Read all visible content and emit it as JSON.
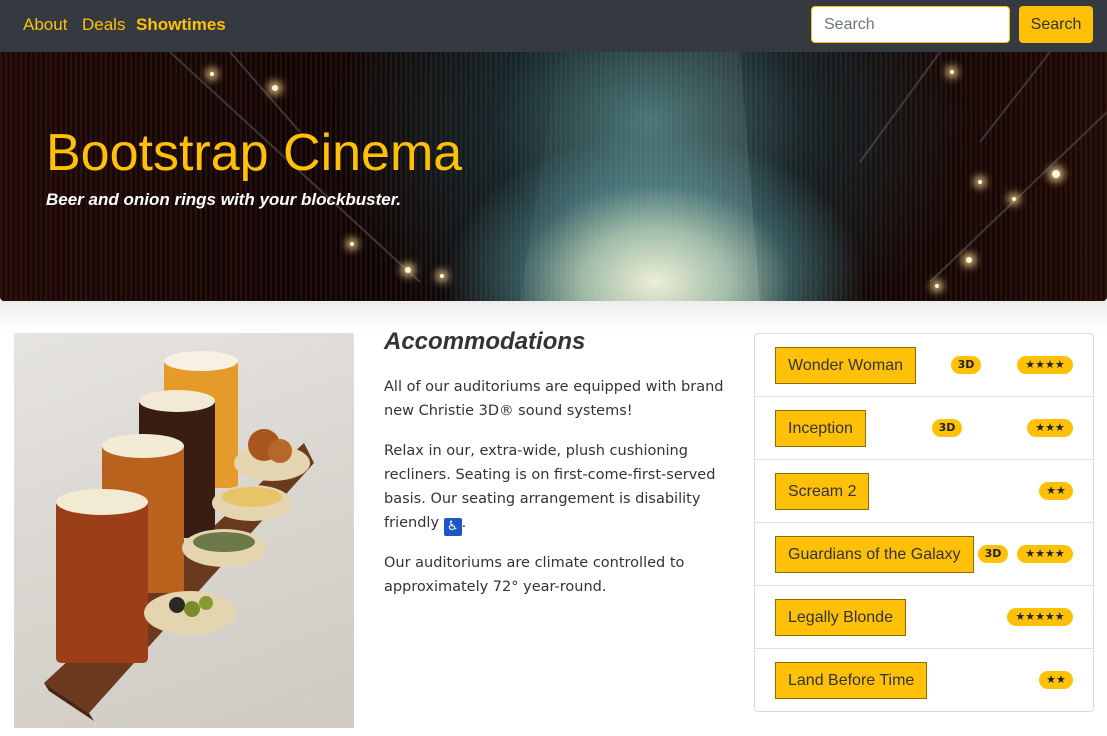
{
  "navbar": {
    "links": [
      {
        "label": "About"
      },
      {
        "label": "Deals"
      },
      {
        "label": "Showtimes"
      }
    ],
    "search": {
      "placeholder": "Search",
      "button_label": "Search"
    }
  },
  "hero": {
    "title": "Bootstrap Cinema",
    "subtitle": "Beer and onion rings with your blockbuster."
  },
  "accommodations": {
    "title": "Accommodations",
    "paragraphs": [
      "All of our auditoriums are equipped with brand new Christie 3D® sound systems!",
      "Relax in our, extra-wide, plush cushioning recliners. Seating is on first-come-first-served basis. Our seating arrangement is disability friendly",
      "Our auditoriums are climate controlled to approximately 72° year-round."
    ],
    "wheelchair_glyph": "♿"
  },
  "movies": [
    {
      "title": "Wonder Woman",
      "format": "3D",
      "rating": "★★★★"
    },
    {
      "title": "Inception",
      "format": "3D",
      "rating": "★★★"
    },
    {
      "title": "Scream 2",
      "format": "",
      "rating": "★★"
    },
    {
      "title": "Guardians of the Galaxy",
      "format": "3D",
      "rating": "★★★★"
    },
    {
      "title": "Legally Blonde",
      "format": "",
      "rating": "★★★★★"
    },
    {
      "title": "Land Before Time",
      "format": "",
      "rating": "★★"
    }
  ],
  "colors": {
    "accent": "#ffc107",
    "navbar_bg": "#343a40"
  }
}
